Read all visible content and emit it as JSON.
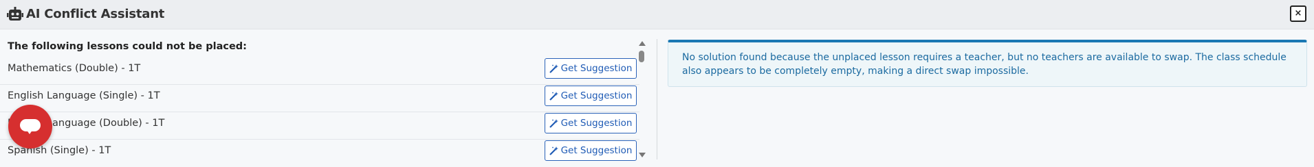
{
  "header": {
    "title": "AI Conflict Assistant",
    "icon": "robot-icon",
    "close_label": "×"
  },
  "left": {
    "heading": "The following lessons could not be placed:",
    "lessons": [
      {
        "label": "Mathematics (Double) - 1T",
        "button": "Get Suggestion"
      },
      {
        "label": "English Language (Single) - 1T",
        "button": "Get Suggestion"
      },
      {
        "label": "English Language (Double) - 1T",
        "button": "Get Suggestion"
      },
      {
        "label": "Spanish (Single) - 1T",
        "button": "Get Suggestion"
      }
    ]
  },
  "right": {
    "message": "No solution found because the unplaced lesson requires a teacher, but no teachers are available to swap. The class schedule also appears to be completely empty, making a direct swap impossible."
  },
  "colors": {
    "accent": "#1a78b3",
    "button_text": "#1f5bb5",
    "chat_fab": "#d62f2f"
  }
}
